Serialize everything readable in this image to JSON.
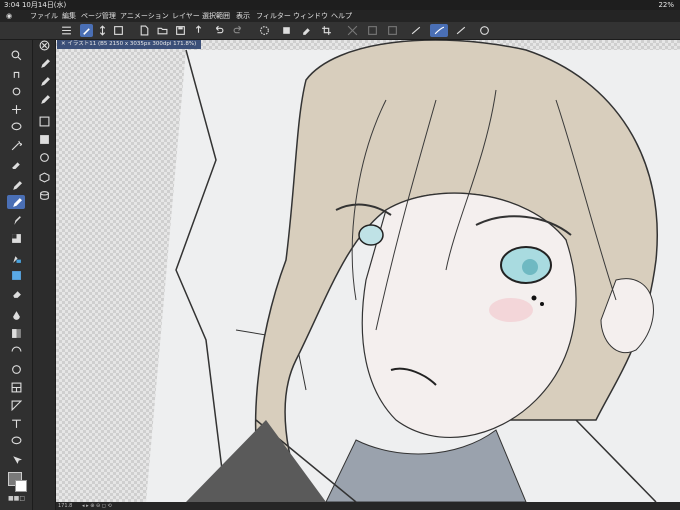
{
  "status": {
    "time": "3:04",
    "date": "10月14日(水)",
    "battery": "22%"
  },
  "menu": [
    "ファイル",
    "編集",
    "ページ管理",
    "アニメーション",
    "レイヤー",
    "選択範囲",
    "表示",
    "フィルター",
    "ウィンドウ",
    "ヘルプ"
  ],
  "document": {
    "tab_title": "イラスト11 (B5 2150 x 3035px 300dpi 171.8%)"
  },
  "bottom": {
    "zoom": "171.8"
  },
  "colors": {
    "accent": "#4a6fb5",
    "main_color": "#7a7a7a",
    "sub_color": "#ffffff"
  },
  "icons": {
    "toolbar": [
      "menu-icon",
      "pen-icon",
      "rotate-icon",
      "transform-icon",
      "new-icon",
      "open-icon",
      "save-icon",
      "export-icon",
      "undo-icon",
      "redo-icon",
      "lasso-icon",
      "fill-icon",
      "eraser-icon",
      "crop-icon",
      "layer-icon",
      "select-icon",
      "brush-icon",
      "stroke-icon",
      "stroke-alt-icon",
      "settings-icon"
    ],
    "tools": [
      "zoom-icon",
      "hand-icon",
      "rotate-view-icon",
      "move-icon",
      "lasso-select-icon",
      "magic-wand-icon",
      "eyedropper-icon",
      "pen-tool-icon",
      "brush-tool-icon",
      "airbrush-icon",
      "decoration-icon",
      "blend-icon",
      "fill-tool-icon",
      "eraser-tool-icon",
      "drop-icon",
      "gradient-icon",
      "shape-icon",
      "figure-icon",
      "frame-icon",
      "ruler-icon",
      "text-icon",
      "balloon-icon",
      "correct-line-icon"
    ]
  }
}
